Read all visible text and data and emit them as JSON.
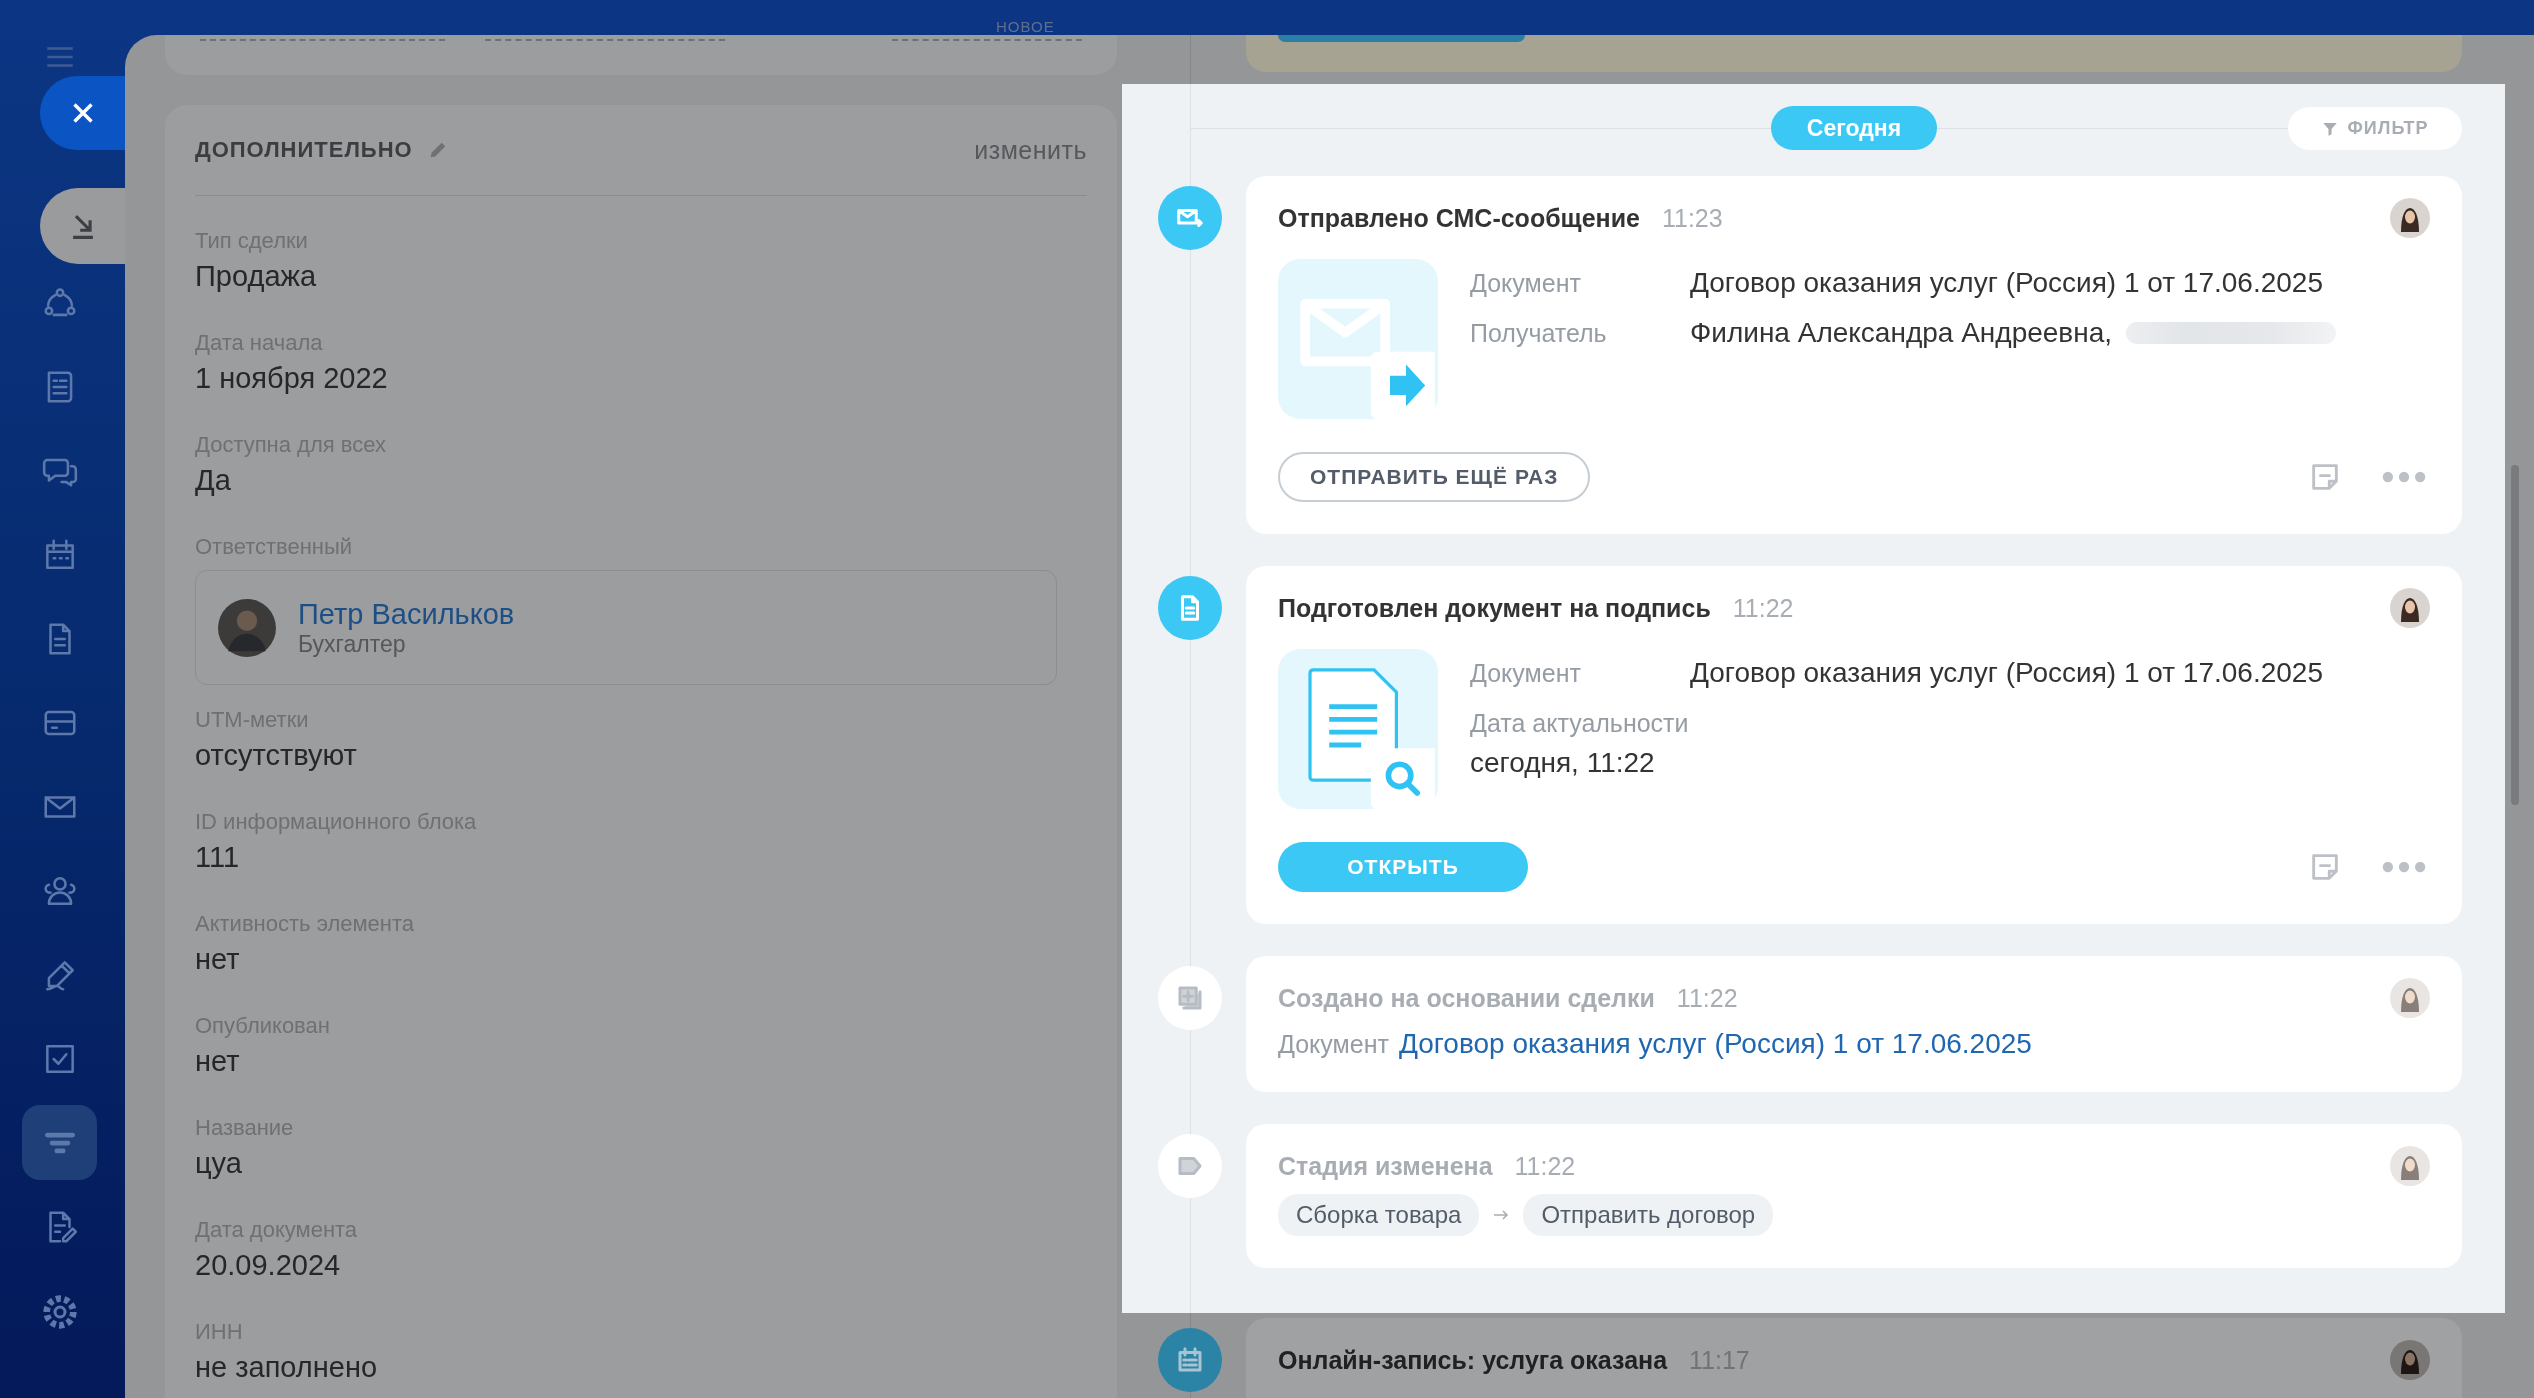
{
  "sidebar": {
    "items": [
      {
        "selected": false
      },
      {
        "selected": false
      },
      {
        "selected": false
      },
      {
        "selected": false
      },
      {
        "selected": false
      },
      {
        "selected": false
      },
      {
        "selected": false
      },
      {
        "selected": false
      },
      {
        "selected": false
      },
      {
        "selected": false
      },
      {
        "selected": true
      },
      {
        "selected": false
      }
    ]
  },
  "top_strip": {
    "tag": "НОВОЕ"
  },
  "deal_panel": {
    "section_title": "ДОПОЛНИТЕЛЬНО",
    "edit_link": "изменить",
    "fields": [
      {
        "kind": "text",
        "label": "Тип сделки",
        "value": "Продажа"
      },
      {
        "kind": "text",
        "label": "Дата начала",
        "value": "1 ноября 2022"
      },
      {
        "kind": "text",
        "label": "Доступна для всех",
        "value": "Да"
      },
      {
        "kind": "user",
        "label": "Ответственный",
        "name": "Петр Васильков",
        "role": "Бухгалтер"
      },
      {
        "kind": "text",
        "label": "UTM-метки",
        "value": "отсутствуют"
      },
      {
        "kind": "text",
        "label": "ID информационного блока",
        "value": "111"
      },
      {
        "kind": "text",
        "label": "Активность элемента",
        "value": "нет"
      },
      {
        "kind": "text",
        "label": "Опубликован",
        "value": "нет"
      },
      {
        "kind": "text",
        "label": "Название",
        "value": "цуа"
      },
      {
        "kind": "text",
        "label": "Дата документа",
        "value": "20.09.2024"
      },
      {
        "kind": "text",
        "label": "ИНН",
        "value": "не заполнено"
      }
    ]
  },
  "timeline": {
    "date_badge": "Сегодня",
    "filter_button": "ФИЛЬТР",
    "items": [
      {
        "kind": "sms",
        "title": "Отправлено СМС-сообщение",
        "time": "11:23",
        "muted": false,
        "fields": [
          {
            "kind": "inline",
            "label": "Документ",
            "value": "Договор оказания услуг (Россия) 1 от 17.06.2025",
            "redacted": false
          },
          {
            "kind": "inline",
            "label": "Получатель",
            "value": "Филина Александра Андреевна,",
            "redacted": true
          }
        ],
        "button": {
          "label": "ОТПРАВИТЬ ЕЩЁ РАЗ"
        }
      },
      {
        "kind": "document",
        "title": "Подготовлен документ на подпись",
        "time": "11:22",
        "muted": false,
        "fields": [
          {
            "kind": "inline",
            "label": "Документ",
            "value": "Договор оказания услуг (Россия) 1 от 17.06.2025",
            "redacted": false
          },
          {
            "kind": "stacked",
            "label": "Дата актуальности",
            "value": "сегодня, 11:22",
            "redacted": false
          }
        ],
        "button": {
          "label": "ОТКРЫТЬ"
        }
      },
      {
        "kind": "created",
        "title": "Создано на основании сделки",
        "time": "11:22",
        "muted": true,
        "document_label": "Документ",
        "document_link": "Договор оказания услуг (Россия) 1 от 17.06.2025"
      },
      {
        "kind": "stage",
        "title": "Стадия изменена",
        "time": "11:22",
        "muted": true,
        "stages": [
          "Сборка товара",
          "Отправить договор"
        ]
      }
    ],
    "background_item": {
      "kind": "booking",
      "title": "Онлайн-запись: услуга оказана",
      "time": "11:17"
    }
  }
}
